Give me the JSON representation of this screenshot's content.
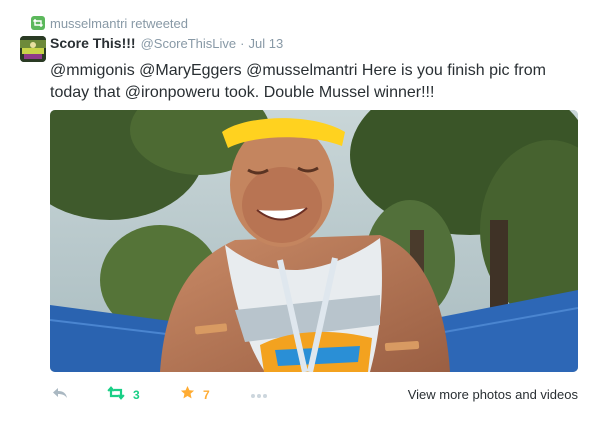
{
  "retweet_context": {
    "text": "musselmantri retweeted"
  },
  "tweet": {
    "fullname": "Score This!!!",
    "username": "@ScoreThisLive",
    "separator": "·",
    "time": "Jul 13",
    "text": "@mmigonis @MaryEggers @musselmantri Here is you finish pic from today that @ironpoweru took. Double Mussel winner!!!"
  },
  "actions": {
    "retweet_count": "3",
    "favorite_count": "7",
    "view_more_label": "View more photos and videos"
  },
  "colors": {
    "retweet_green": "#19cf86",
    "favorite_orange": "#ffac33",
    "muted_gray": "#8899a6",
    "text_dark": "#292f33"
  },
  "icons": {
    "retweet_context": "retweet-icon",
    "reply": "reply-icon",
    "retweet": "retweet-icon",
    "favorite": "star-icon",
    "more": "ellipsis-icon"
  },
  "media": {
    "type": "photo"
  }
}
